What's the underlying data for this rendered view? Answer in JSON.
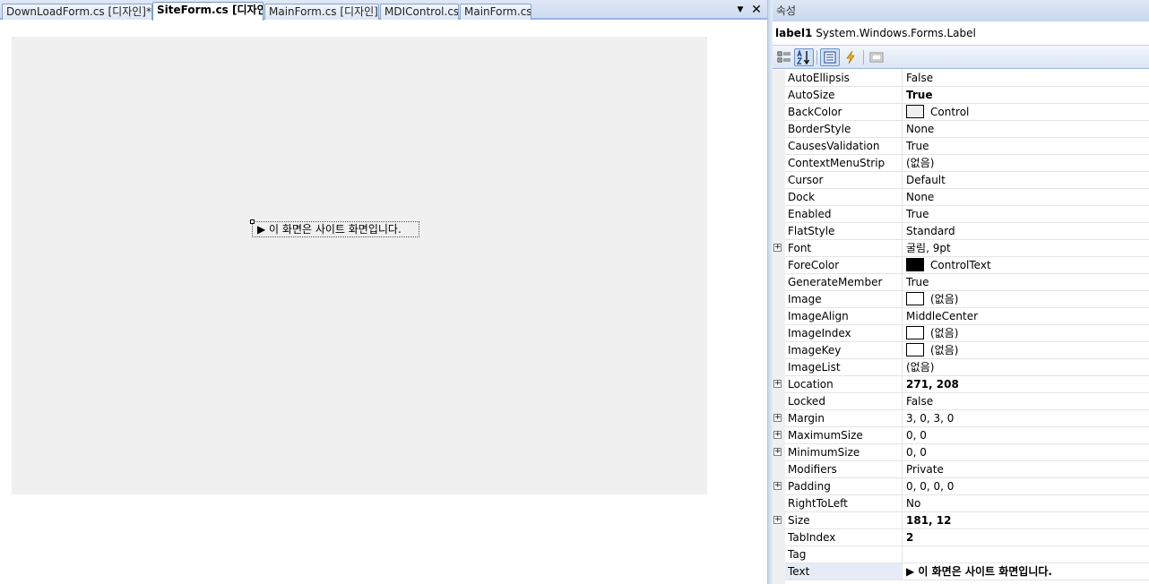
{
  "doc_tabs": {
    "items": [
      {
        "label": "DownLoadForm.cs [디자인]*",
        "active": false
      },
      {
        "label": "SiteForm.cs [디자인]",
        "active": true
      },
      {
        "label": "MainForm.cs [디자인]",
        "active": false
      },
      {
        "label": "MDIControl.cs",
        "active": false
      },
      {
        "label": "MainForm.cs",
        "active": false
      }
    ],
    "dropdown_glyph": "▼",
    "close_glyph": "✕"
  },
  "designer": {
    "label_text": "▶ 이 화면은 사이트 화면입니다."
  },
  "properties": {
    "title": "속성",
    "object_name": "label1",
    "object_type": "System.Windows.Forms.Label",
    "toolbar": {
      "buttons": [
        {
          "name": "categorized",
          "icon": "categorized-icon",
          "pressed": false
        },
        {
          "name": "alphabetical",
          "icon": "alphabetical-icon",
          "pressed": true
        },
        {
          "name": "properties",
          "icon": "properties-icon",
          "pressed": true
        },
        {
          "name": "events",
          "icon": "events-lightning-icon",
          "pressed": false
        },
        {
          "name": "property-pages",
          "icon": "property-pages-icon",
          "pressed": false
        }
      ]
    },
    "rows": [
      {
        "name": "AutoEllipsis",
        "value": "False"
      },
      {
        "name": "AutoSize",
        "value": "True",
        "bold": true
      },
      {
        "name": "BackColor",
        "value": "Control",
        "swatch": "#f0f0f0"
      },
      {
        "name": "BorderStyle",
        "value": "None"
      },
      {
        "name": "CausesValidation",
        "value": "True"
      },
      {
        "name": "ContextMenuStrip",
        "value": "(없음)"
      },
      {
        "name": "Cursor",
        "value": "Default"
      },
      {
        "name": "Dock",
        "value": "None"
      },
      {
        "name": "Enabled",
        "value": "True"
      },
      {
        "name": "FlatStyle",
        "value": "Standard"
      },
      {
        "name": "Font",
        "value": "굴림, 9pt",
        "expandable": true
      },
      {
        "name": "ForeColor",
        "value": "ControlText",
        "swatch": "#000000"
      },
      {
        "name": "GenerateMember",
        "value": "True"
      },
      {
        "name": "Image",
        "value": "(없음)",
        "swatch": "#ffffff"
      },
      {
        "name": "ImageAlign",
        "value": "MiddleCenter"
      },
      {
        "name": "ImageIndex",
        "value": "(없음)",
        "swatch": "#ffffff"
      },
      {
        "name": "ImageKey",
        "value": "(없음)",
        "swatch": "#ffffff"
      },
      {
        "name": "ImageList",
        "value": "(없음)"
      },
      {
        "name": "Location",
        "value": "271, 208",
        "bold": true,
        "expandable": true
      },
      {
        "name": "Locked",
        "value": "False"
      },
      {
        "name": "Margin",
        "value": "3, 0, 3, 0",
        "expandable": true
      },
      {
        "name": "MaximumSize",
        "value": "0, 0",
        "expandable": true
      },
      {
        "name": "MinimumSize",
        "value": "0, 0",
        "expandable": true
      },
      {
        "name": "Modifiers",
        "value": "Private"
      },
      {
        "name": "Padding",
        "value": "0, 0, 0, 0",
        "expandable": true
      },
      {
        "name": "RightToLeft",
        "value": "No"
      },
      {
        "name": "Size",
        "value": "181, 12",
        "bold": true,
        "expandable": true
      },
      {
        "name": "TabIndex",
        "value": "2",
        "bold": true
      },
      {
        "name": "Tag",
        "value": ""
      },
      {
        "name": "Text",
        "value": "▶ 이 화면은 사이트 화면입니다.",
        "bold": true,
        "selected": true
      }
    ]
  },
  "colors": {
    "tab_border": "#98b4e4",
    "form_background": "#f0f0f0",
    "grid_line": "#e4e4e4",
    "selected_row": "#e6ecf7"
  }
}
